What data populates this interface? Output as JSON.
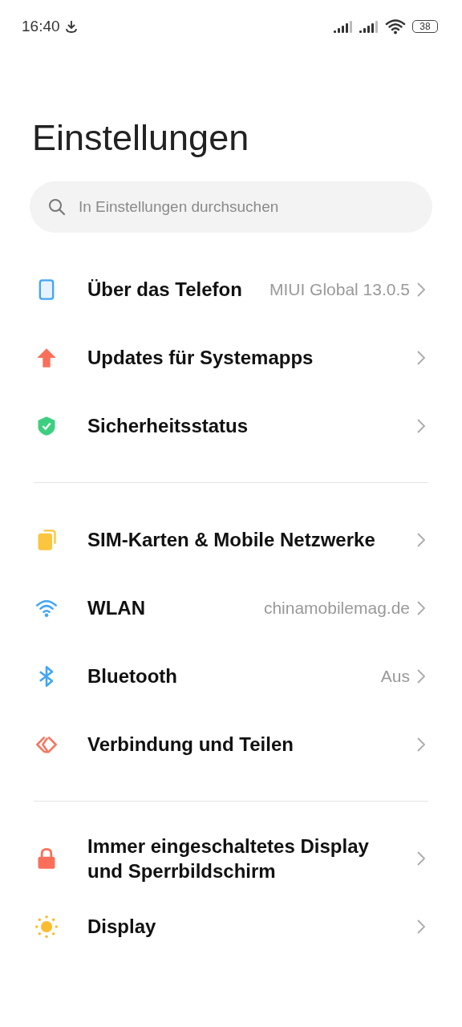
{
  "status_bar": {
    "time": "16:40",
    "battery": "38"
  },
  "title": "Einstellungen",
  "search": {
    "placeholder": "In Einstellungen durchsuchen"
  },
  "groups": [
    {
      "items": [
        {
          "label": "Über das Telefon",
          "value": "MIUI Global 13.0.5"
        },
        {
          "label": "Updates für Systemapps"
        },
        {
          "label": "Sicherheitsstatus"
        }
      ]
    },
    {
      "items": [
        {
          "label": "SIM-Karten & Mobile Netzwerke"
        },
        {
          "label": "WLAN",
          "value": "chinamobilemag.de"
        },
        {
          "label": "Bluetooth",
          "value": "Aus"
        },
        {
          "label": "Verbindung und Teilen"
        }
      ]
    },
    {
      "items": [
        {
          "label": "Immer eingeschaltetes Display und Sperrbildschirm"
        },
        {
          "label": "Display"
        }
      ]
    }
  ]
}
